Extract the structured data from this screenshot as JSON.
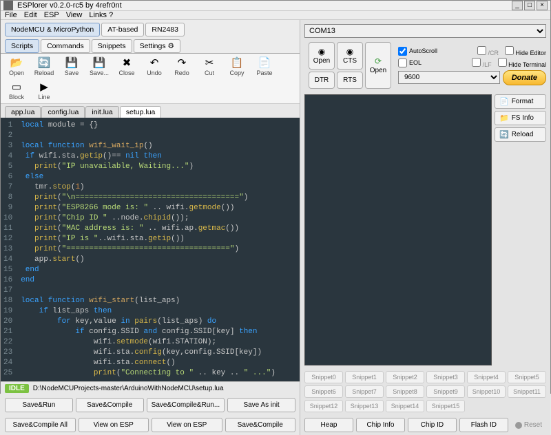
{
  "window": {
    "title": "ESPlorer v0.2.0-rc5 by 4refr0nt"
  },
  "menu": [
    "File",
    "Edit",
    "ESP",
    "View",
    "Links ?"
  ],
  "main_tabs": [
    "NodeMCU & MicroPython",
    "AT-based",
    "RN2483"
  ],
  "sub_tabs": [
    "Scripts",
    "Commands",
    "Snippets",
    "Settings"
  ],
  "toolbar": [
    {
      "icon": "📂",
      "label": "Open"
    },
    {
      "icon": "🔄",
      "label": "Reload"
    },
    {
      "icon": "💾",
      "label": "Save"
    },
    {
      "icon": "💾",
      "label": "Save..."
    },
    {
      "icon": "✖",
      "label": "Close"
    },
    {
      "icon": "↶",
      "label": "Undo"
    },
    {
      "icon": "↷",
      "label": "Redo"
    },
    {
      "icon": "✂",
      "label": "Cut"
    },
    {
      "icon": "📋",
      "label": "Copy"
    },
    {
      "icon": "📄",
      "label": "Paste"
    },
    {
      "icon": "▭",
      "label": "Block"
    },
    {
      "icon": "▶",
      "label": "Line"
    }
  ],
  "file_tabs": [
    "app.lua",
    "config.lua",
    "init.lua",
    "setup.lua"
  ],
  "active_file": 3,
  "status": {
    "state": "IDLE",
    "path": "D:\\NodeMCUProjects-master\\ArduinoWithNodeMCU\\setup.lua"
  },
  "left_buttons_row1": [
    "Save&Run",
    "Save&Compile",
    "Save&Compile&Run...",
    "Save As init"
  ],
  "left_buttons_row2": [
    "Save&Compile All",
    "View on ESP",
    "View on ESP",
    "Save&Compile"
  ],
  "port": "COM13",
  "conn": {
    "open": "Open",
    "cts": "CTS",
    "rts": "RTS",
    "dtr": "DTR",
    "open2": "Open"
  },
  "baud": "9600",
  "checks": {
    "autoscroll": "AutoScroll",
    "eol": "EOL",
    "cr": "/CR",
    "hide_editor": "Hide Editor",
    "lf": "/LF",
    "hide_term": "Hide Terminal"
  },
  "donate": "Donate",
  "side_buttons": [
    {
      "icon": "📄",
      "label": "Format"
    },
    {
      "icon": "📁",
      "label": "FS Info"
    },
    {
      "icon": "🔄",
      "label": "Reload"
    }
  ],
  "snippets": [
    "Snippet0",
    "Snippet1",
    "Snippet2",
    "Snippet3",
    "Snippet4",
    "Snippet5",
    "Snippet6",
    "Snippet7",
    "Snippet8",
    "Snippet9",
    "Snippet10",
    "Snippet11",
    "Snippet12",
    "Snippet13",
    "Snippet14",
    "Snippet15"
  ],
  "bot_buttons": [
    "Heap",
    "Chip Info",
    "Chip ID",
    "Flash ID"
  ],
  "reset": "Reset",
  "code_lines": [
    [
      {
        "t": "local",
        "c": "kw"
      },
      {
        "t": " module = {}",
        "c": ""
      }
    ],
    [],
    [
      {
        "t": "local function",
        "c": "kw"
      },
      {
        "t": " ",
        "c": ""
      },
      {
        "t": "wifi_wait_ip",
        "c": "nm"
      },
      {
        "t": "()",
        "c": ""
      }
    ],
    [
      {
        "t": " if",
        "c": "kw"
      },
      {
        "t": " wifi.sta.",
        "c": ""
      },
      {
        "t": "getip",
        "c": "fn"
      },
      {
        "t": "()== ",
        "c": ""
      },
      {
        "t": "nil",
        "c": "kw"
      },
      {
        "t": " then",
        "c": "kw"
      }
    ],
    [
      {
        "t": "   ",
        "c": ""
      },
      {
        "t": "print",
        "c": "fn"
      },
      {
        "t": "(",
        "c": ""
      },
      {
        "t": "\"IP unavailable, Waiting...\"",
        "c": "str"
      },
      {
        "t": ")",
        "c": ""
      }
    ],
    [
      {
        "t": " else",
        "c": "kw"
      }
    ],
    [
      {
        "t": "   tmr.",
        "c": ""
      },
      {
        "t": "stop",
        "c": "fn"
      },
      {
        "t": "(",
        "c": ""
      },
      {
        "t": "1",
        "c": "num"
      },
      {
        "t": ")",
        "c": ""
      }
    ],
    [
      {
        "t": "   ",
        "c": ""
      },
      {
        "t": "print",
        "c": "fn"
      },
      {
        "t": "(",
        "c": ""
      },
      {
        "t": "\"\\n====================================\"",
        "c": "str"
      },
      {
        "t": ")",
        "c": ""
      }
    ],
    [
      {
        "t": "   ",
        "c": ""
      },
      {
        "t": "print",
        "c": "fn"
      },
      {
        "t": "(",
        "c": ""
      },
      {
        "t": "\"ESP8266 mode is: \"",
        "c": "str"
      },
      {
        "t": " .. wifi.",
        "c": ""
      },
      {
        "t": "getmode",
        "c": "fn"
      },
      {
        "t": "())",
        "c": ""
      }
    ],
    [
      {
        "t": "   ",
        "c": ""
      },
      {
        "t": "print",
        "c": "fn"
      },
      {
        "t": "(",
        "c": ""
      },
      {
        "t": "\"Chip ID \"",
        "c": "str"
      },
      {
        "t": " ..node.",
        "c": ""
      },
      {
        "t": "chipid",
        "c": "fn"
      },
      {
        "t": "());",
        "c": ""
      }
    ],
    [
      {
        "t": "   ",
        "c": ""
      },
      {
        "t": "print",
        "c": "fn"
      },
      {
        "t": "(",
        "c": ""
      },
      {
        "t": "\"MAC address is: \"",
        "c": "str"
      },
      {
        "t": " .. wifi.ap.",
        "c": ""
      },
      {
        "t": "getmac",
        "c": "fn"
      },
      {
        "t": "())",
        "c": ""
      }
    ],
    [
      {
        "t": "   ",
        "c": ""
      },
      {
        "t": "print",
        "c": "fn"
      },
      {
        "t": "(",
        "c": ""
      },
      {
        "t": "\"IP is \"",
        "c": "str"
      },
      {
        "t": "..wifi.sta.",
        "c": ""
      },
      {
        "t": "getip",
        "c": "fn"
      },
      {
        "t": "())",
        "c": ""
      }
    ],
    [
      {
        "t": "   ",
        "c": ""
      },
      {
        "t": "print",
        "c": "fn"
      },
      {
        "t": "(",
        "c": ""
      },
      {
        "t": "\"====================================\"",
        "c": "str"
      },
      {
        "t": ")",
        "c": ""
      }
    ],
    [
      {
        "t": "   app.",
        "c": ""
      },
      {
        "t": "start",
        "c": "fn"
      },
      {
        "t": "()",
        "c": ""
      }
    ],
    [
      {
        "t": " end",
        "c": "kw"
      }
    ],
    [
      {
        "t": "end",
        "c": "kw"
      }
    ],
    [],
    [
      {
        "t": "local function",
        "c": "kw"
      },
      {
        "t": " ",
        "c": ""
      },
      {
        "t": "wifi_start",
        "c": "nm"
      },
      {
        "t": "(list_aps)",
        "c": ""
      }
    ],
    [
      {
        "t": "    if",
        "c": "kw"
      },
      {
        "t": " list_aps ",
        "c": ""
      },
      {
        "t": "then",
        "c": "kw"
      }
    ],
    [
      {
        "t": "        for",
        "c": "kw"
      },
      {
        "t": " key,value ",
        "c": ""
      },
      {
        "t": "in",
        "c": "kw"
      },
      {
        "t": " ",
        "c": ""
      },
      {
        "t": "pairs",
        "c": "fn"
      },
      {
        "t": "(list_aps) ",
        "c": ""
      },
      {
        "t": "do",
        "c": "kw"
      }
    ],
    [
      {
        "t": "            if",
        "c": "kw"
      },
      {
        "t": " config.SSID ",
        "c": ""
      },
      {
        "t": "and",
        "c": "kw"
      },
      {
        "t": " config.SSID[key] ",
        "c": ""
      },
      {
        "t": "then",
        "c": "kw"
      }
    ],
    [
      {
        "t": "                wifi.",
        "c": ""
      },
      {
        "t": "setmode",
        "c": "fn"
      },
      {
        "t": "(wifi.STATION);",
        "c": ""
      }
    ],
    [
      {
        "t": "                wifi.sta.",
        "c": ""
      },
      {
        "t": "config",
        "c": "fn"
      },
      {
        "t": "(key,config.SSID[key])",
        "c": ""
      }
    ],
    [
      {
        "t": "                wifi.sta.",
        "c": ""
      },
      {
        "t": "connect",
        "c": "fn"
      },
      {
        "t": "()",
        "c": ""
      }
    ],
    [
      {
        "t": "                ",
        "c": ""
      },
      {
        "t": "print",
        "c": "fn"
      },
      {
        "t": "(",
        "c": ""
      },
      {
        "t": "\"Connecting to \"",
        "c": "str"
      },
      {
        "t": " .. key .. ",
        "c": ""
      },
      {
        "t": "\" ...\"",
        "c": "str"
      },
      {
        "t": ")",
        "c": ""
      }
    ]
  ]
}
